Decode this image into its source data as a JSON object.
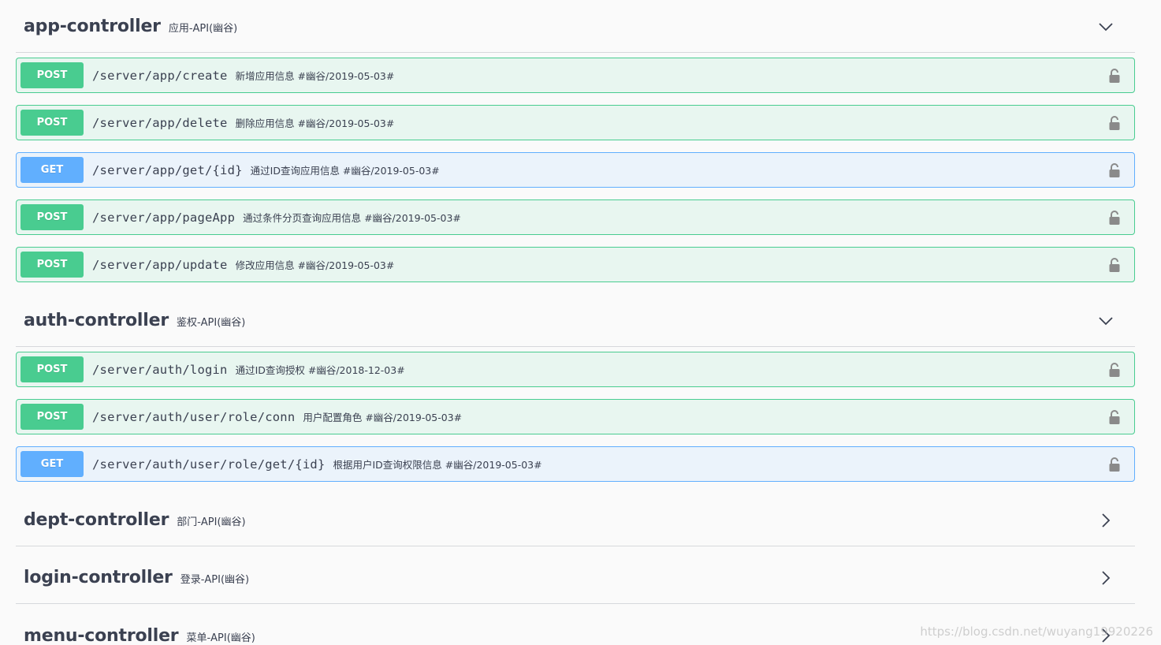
{
  "tags": [
    {
      "name": "app-controller",
      "description": "应用-API(幽谷)",
      "expanded": true,
      "operations": [
        {
          "method": "POST",
          "path": "/server/app/create",
          "summary": "新增应用信息 #幽谷/2019-05-03#"
        },
        {
          "method": "POST",
          "path": "/server/app/delete",
          "summary": "删除应用信息 #幽谷/2019-05-03#"
        },
        {
          "method": "GET",
          "path": "/server/app/get/{id}",
          "summary": "通过ID查询应用信息 #幽谷/2019-05-03#"
        },
        {
          "method": "POST",
          "path": "/server/app/pageApp",
          "summary": "通过条件分页查询应用信息 #幽谷/2019-05-03#"
        },
        {
          "method": "POST",
          "path": "/server/app/update",
          "summary": "修改应用信息 #幽谷/2019-05-03#"
        }
      ]
    },
    {
      "name": "auth-controller",
      "description": "鉴权-API(幽谷)",
      "expanded": true,
      "operations": [
        {
          "method": "POST",
          "path": "/server/auth/login",
          "summary": "通过ID查询授权 #幽谷/2018-12-03#"
        },
        {
          "method": "POST",
          "path": "/server/auth/user/role/conn",
          "summary": "用户配置角色 #幽谷/2019-05-03#"
        },
        {
          "method": "GET",
          "path": "/server/auth/user/role/get/{id}",
          "summary": "根据用户ID查询权限信息 #幽谷/2019-05-03#"
        }
      ]
    },
    {
      "name": "dept-controller",
      "description": "部门-API(幽谷)",
      "expanded": false,
      "operations": []
    },
    {
      "name": "login-controller",
      "description": "登录-API(幽谷)",
      "expanded": false,
      "operations": []
    },
    {
      "name": "menu-controller",
      "description": "菜单-API(幽谷)",
      "expanded": false,
      "operations": []
    }
  ],
  "watermark": "https://blog.csdn.net/wuyang19920226",
  "colors": {
    "post": "#49cc90",
    "get": "#61affe",
    "text": "#3b4151"
  },
  "icons": {
    "expanded": "chevron-down-icon",
    "collapsed": "chevron-right-icon",
    "auth": "lock-icon"
  }
}
